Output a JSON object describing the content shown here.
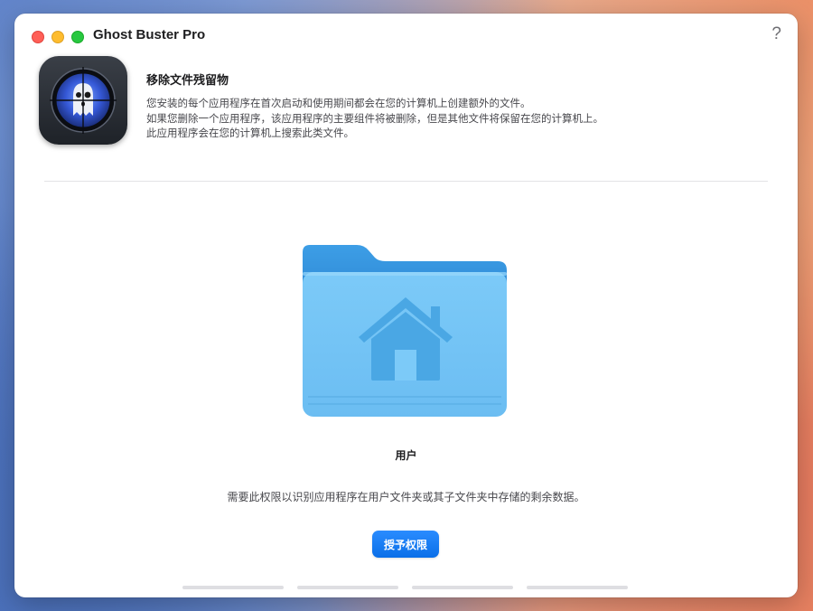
{
  "window": {
    "title": "Ghost Buster Pro",
    "help_label": "?"
  },
  "header": {
    "heading": "移除文件残留物",
    "description": [
      "您安装的每个应用程序在首次启动和使用期间都会在您的计算机上创建额外的文件。",
      "如果您删除一个应用程序，该应用程序的主要组件将被删除，但是其他文件将保留在您的计算机上。",
      "此应用程序会在您的计算机上搜索此类文件。"
    ]
  },
  "main": {
    "folder_label": "用户",
    "permission_description": "需要此权限以识别应用程序在用户文件夹或其子文件夹中存储的剩余数据。",
    "grant_button_label": "授予权限"
  },
  "pager": {
    "step_count": 4
  },
  "icons": {
    "app": "ghost-crosshair-icon",
    "folder": "home-folder-icon"
  },
  "colors": {
    "accent": "#0a6fe8",
    "folder_light": "#74c5f5",
    "folder_dark": "#4aa7e4"
  }
}
